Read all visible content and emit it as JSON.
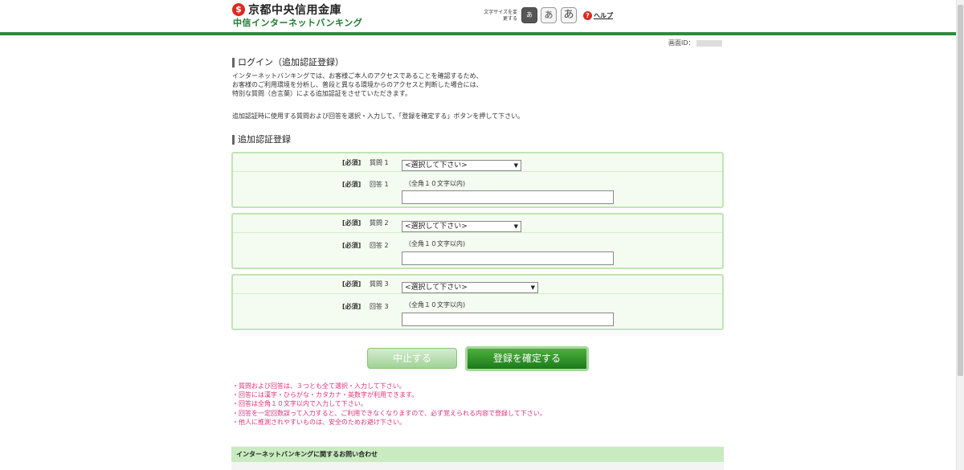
{
  "header": {
    "bank_name": "京都中央信用金庫",
    "bank_sub": "中信インターネットバンキング",
    "font_size_label": "文字サイズを変更する",
    "font_sizes": [
      "あ",
      "あ",
      "あ"
    ],
    "help": "ヘルプ",
    "screen_id_label": "画面ID："
  },
  "page": {
    "title": "ログイン（追加認証登録）",
    "intro_lines": [
      "インターネットバンキングでは、お客様ご本人のアクセスであることを確認するため、",
      "お客様のご利用環境を分析し、普段と異なる環境からのアクセスと判断した場合には、",
      "特別な質問（合言葉）による追加認証をさせていただきます。"
    ],
    "instruction": "追加認証時に使用する質問および回答を選択・入力して、「登録を確定する」ボタンを押して下さい。",
    "section_title": "追加認証登録"
  },
  "form": {
    "required": "[必須]",
    "hint": "（全角１０文字以内)",
    "select_placeholder": "<選択して下さい>",
    "q1_label": "質問 1",
    "a1_label": "回答 1",
    "q2_label": "質問 2",
    "a2_label": "回答 2",
    "q3_label": "質問 3",
    "a3_label": "回答 3"
  },
  "buttons": {
    "cancel": "中止する",
    "confirm": "登録を確定する"
  },
  "notes": [
    "・質問および回答は、３つとも全て選択・入力して下さい。",
    "・回答には漢字・ひらがな・カタカナ・英数字が利用できます。",
    "・回答は全角１０文字以内で入力して下さい。",
    "・回答を一定回数誤って入力すると、ご利用できなくなりますので、必ず覚えられる内容で登録して下さい。",
    "・他人に推測されやすいものは、安全のためお避け下さい。"
  ],
  "contact": {
    "title": "インターネットバンキングに関するお問い合わせ"
  },
  "colors": {
    "brand_green": "#2f8a3c",
    "box_border": "#bfe5b4",
    "note_pink": "#e0317a"
  }
}
